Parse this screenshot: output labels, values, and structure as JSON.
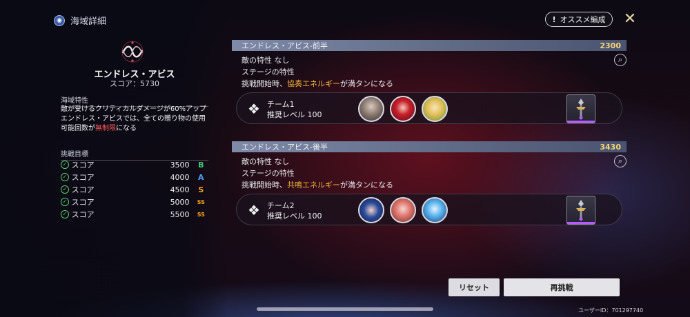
{
  "header": {
    "title": "海域詳細",
    "recommend_label": "オススメ編成",
    "recommend_mark": "!"
  },
  "sea": {
    "name": "エンドレス・アビス",
    "score_text": "スコア：5730"
  },
  "features": {
    "heading": "海域特性",
    "line1": "敵が受けるクリティカルダメージが60%アップ",
    "line2": "エンドレス・アビスでは、全ての贈り物の使用",
    "line3_prefix": "可能回数が",
    "line3_highlight": "無制限",
    "line3_suffix": "になる"
  },
  "goals": {
    "heading": "挑戦目標",
    "items": [
      {
        "label": "スコア",
        "value": "3500",
        "rank": "B",
        "color": "#3fc87a"
      },
      {
        "label": "スコア",
        "value": "4000",
        "rank": "A",
        "color": "#4aa0ff"
      },
      {
        "label": "スコア",
        "value": "4500",
        "rank": "S",
        "color": "#f3a21f"
      },
      {
        "label": "スコア",
        "value": "5000",
        "rank": "SS",
        "color": "#f3a21f"
      },
      {
        "label": "スコア",
        "value": "5500",
        "rank": "SS",
        "color": "#f3a21f"
      }
    ]
  },
  "stages": [
    {
      "title": "エンドレス・アビス-前半",
      "score": "2300",
      "enemy_trait": "敵の特性  なし",
      "stage_trait": "ステージの特性",
      "effect_prefix": "挑戦開始時、",
      "effect_highlight": "協奏エネルギー",
      "effect_suffix": "が満タンになる",
      "team_name": "チーム1",
      "team_level": "推奨レベル 100"
    },
    {
      "title": "エンドレス・アビス-後半",
      "score": "3430",
      "enemy_trait": "敵の特性  なし",
      "stage_trait": "ステージの特性",
      "effect_prefix": "挑戦開始時、",
      "effect_highlight": "共鳴エネルギー",
      "effect_suffix": "が満タンになる",
      "team_name": "チーム2",
      "team_level": "推奨レベル 100"
    }
  ],
  "buttons": {
    "reset": "リセット",
    "retry": "再挑戦"
  },
  "user_id": "ユーザーID：701297740"
}
